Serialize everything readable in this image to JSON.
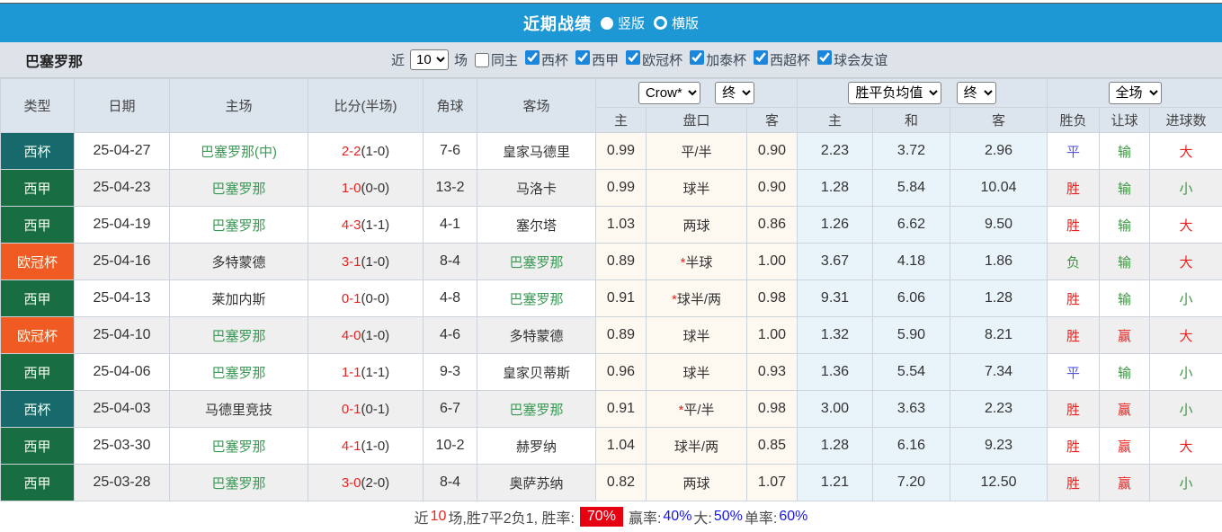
{
  "title_bar": {
    "title": "近期战绩",
    "vertical_label": "竖版",
    "horizontal_label": "横版"
  },
  "filter_bar": {
    "team": "巴塞罗那",
    "near_label": "近",
    "count_value": "10",
    "games_label": "场",
    "same_home_label": "同主",
    "competitions": [
      "西杯",
      "西甲",
      "欧冠杯",
      "加泰杯",
      "西超杯",
      "球会友谊"
    ]
  },
  "table": {
    "headers_left": [
      "类型",
      "日期",
      "主场",
      "比分(半场)",
      "角球",
      "客场"
    ],
    "dropdowns": {
      "bookmaker": "Crow*",
      "bookmaker_time": "终",
      "avg": "胜平负均值",
      "avg_time": "终",
      "scope": "全场"
    },
    "subheaders": [
      "主",
      "盘口",
      "客",
      "主",
      "和",
      "客",
      "胜负",
      "让球",
      "进球数"
    ],
    "rows": [
      {
        "type": "西杯",
        "type_color": "teal",
        "date": "25-04-27",
        "home": "巴塞罗那(中)",
        "home_green": true,
        "score": "2-2",
        "half": "(1-0)",
        "corner": "7-6",
        "away": "皇家马德里",
        "away_green": false,
        "h_home": "0.99",
        "star": false,
        "line": "平/半",
        "h_away": "0.90",
        "e_home": "2.23",
        "e_draw": "3.72",
        "e_away": "2.96",
        "result": "平",
        "result_color": "blue",
        "let": "输",
        "let_color": "green",
        "goals": "大",
        "goals_color": "red"
      },
      {
        "type": "西甲",
        "type_color": "green",
        "date": "25-04-23",
        "home": "巴塞罗那",
        "home_green": true,
        "score": "1-0",
        "half": "(0-0)",
        "corner": "13-2",
        "away": "马洛卡",
        "away_green": false,
        "h_home": "0.99",
        "star": false,
        "line": "球半",
        "h_away": "0.90",
        "e_home": "1.28",
        "e_draw": "5.84",
        "e_away": "10.04",
        "result": "胜",
        "result_color": "red",
        "let": "输",
        "let_color": "green",
        "goals": "小",
        "goals_color": "green"
      },
      {
        "type": "西甲",
        "type_color": "green",
        "date": "25-04-19",
        "home": "巴塞罗那",
        "home_green": true,
        "score": "4-3",
        "half": "(1-1)",
        "corner": "4-1",
        "away": "塞尔塔",
        "away_green": false,
        "h_home": "1.03",
        "star": false,
        "line": "两球",
        "h_away": "0.86",
        "e_home": "1.26",
        "e_draw": "6.62",
        "e_away": "9.50",
        "result": "胜",
        "result_color": "red",
        "let": "输",
        "let_color": "green",
        "goals": "大",
        "goals_color": "red"
      },
      {
        "type": "欧冠杯",
        "type_color": "orange",
        "date": "25-04-16",
        "home": "多特蒙德",
        "home_green": false,
        "score": "3-1",
        "half": "(1-0)",
        "corner": "8-4",
        "away": "巴塞罗那",
        "away_green": true,
        "h_home": "0.89",
        "star": true,
        "line": "半球",
        "h_away": "1.00",
        "e_home": "3.67",
        "e_draw": "4.18",
        "e_away": "1.86",
        "result": "负",
        "result_color": "green",
        "let": "输",
        "let_color": "green",
        "goals": "大",
        "goals_color": "red"
      },
      {
        "type": "西甲",
        "type_color": "green",
        "date": "25-04-13",
        "home": "莱加内斯",
        "home_green": false,
        "score": "0-1",
        "half": "(0-0)",
        "corner": "4-8",
        "away": "巴塞罗那",
        "away_green": true,
        "h_home": "0.91",
        "star": true,
        "line": "球半/两",
        "h_away": "0.98",
        "e_home": "9.31",
        "e_draw": "6.06",
        "e_away": "1.28",
        "result": "胜",
        "result_color": "red",
        "let": "输",
        "let_color": "green",
        "goals": "小",
        "goals_color": "green"
      },
      {
        "type": "欧冠杯",
        "type_color": "orange",
        "date": "25-04-10",
        "home": "巴塞罗那",
        "home_green": true,
        "score": "4-0",
        "half": "(1-0)",
        "corner": "4-6",
        "away": "多特蒙德",
        "away_green": false,
        "h_home": "0.89",
        "star": false,
        "line": "球半",
        "h_away": "1.00",
        "e_home": "1.32",
        "e_draw": "5.90",
        "e_away": "8.21",
        "result": "胜",
        "result_color": "red",
        "let": "赢",
        "let_color": "red",
        "goals": "大",
        "goals_color": "red"
      },
      {
        "type": "西甲",
        "type_color": "green",
        "date": "25-04-06",
        "home": "巴塞罗那",
        "home_green": true,
        "score": "1-1",
        "half": "(1-1)",
        "corner": "9-3",
        "away": "皇家贝蒂斯",
        "away_green": false,
        "h_home": "0.96",
        "star": false,
        "line": "球半",
        "h_away": "0.93",
        "e_home": "1.36",
        "e_draw": "5.54",
        "e_away": "7.34",
        "result": "平",
        "result_color": "blue",
        "let": "输",
        "let_color": "green",
        "goals": "小",
        "goals_color": "green"
      },
      {
        "type": "西杯",
        "type_color": "teal",
        "date": "25-04-03",
        "home": "马德里竞技",
        "home_green": false,
        "score": "0-1",
        "half": "(0-1)",
        "corner": "6-7",
        "away": "巴塞罗那",
        "away_green": true,
        "h_home": "0.91",
        "star": true,
        "line": "平/半",
        "h_away": "0.98",
        "e_home": "3.00",
        "e_draw": "3.63",
        "e_away": "2.23",
        "result": "胜",
        "result_color": "red",
        "let": "赢",
        "let_color": "red",
        "goals": "小",
        "goals_color": "green"
      },
      {
        "type": "西甲",
        "type_color": "green",
        "date": "25-03-30",
        "home": "巴塞罗那",
        "home_green": true,
        "score": "4-1",
        "half": "(1-0)",
        "corner": "10-2",
        "away": "赫罗纳",
        "away_green": false,
        "h_home": "1.04",
        "star": false,
        "line": "球半/两",
        "h_away": "0.85",
        "e_home": "1.28",
        "e_draw": "6.16",
        "e_away": "9.23",
        "result": "胜",
        "result_color": "red",
        "let": "赢",
        "let_color": "red",
        "goals": "大",
        "goals_color": "red"
      },
      {
        "type": "西甲",
        "type_color": "green",
        "date": "25-03-28",
        "home": "巴塞罗那",
        "home_green": true,
        "score": "3-0",
        "half": "(2-0)",
        "corner": "8-4",
        "away": "奥萨苏纳",
        "away_green": false,
        "h_home": "0.82",
        "star": false,
        "line": "两球",
        "h_away": "1.07",
        "e_home": "1.21",
        "e_draw": "7.20",
        "e_away": "12.50",
        "result": "胜",
        "result_color": "red",
        "let": "赢",
        "let_color": "red",
        "goals": "小",
        "goals_color": "green"
      }
    ]
  },
  "summary": {
    "segments": [
      {
        "text": "近",
        "style": "dark"
      },
      {
        "text": "10",
        "style": "red"
      },
      {
        "text": "场,胜7平2负1, 胜率: ",
        "style": "dark"
      },
      {
        "text": "70%",
        "style": "badge"
      },
      {
        "text": " 赢率:",
        "style": "dark"
      },
      {
        "text": "40%",
        "style": "blue"
      },
      {
        "text": " 大:",
        "style": "dark"
      },
      {
        "text": "50%",
        "style": "blue"
      },
      {
        "text": " 单率:",
        "style": "dark"
      },
      {
        "text": "60%",
        "style": "blue"
      }
    ]
  },
  "colors": {
    "title_bar_blue": "#1e98d5",
    "badge_teal": "#17696b",
    "badge_green": "#186e40",
    "badge_orange": "#f05b23",
    "team_green": "#3a9a55",
    "score_red": "#e8231f",
    "result_red": "#e8231f",
    "result_green": "#3f9545",
    "result_blue": "#5555dd",
    "summary_blue": "#1717e6",
    "summary_badge_bg": "#e60012"
  }
}
